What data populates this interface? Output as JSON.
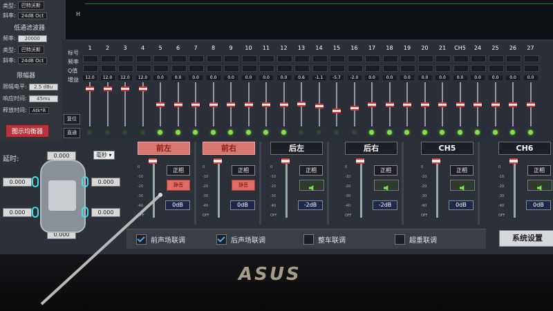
{
  "left_panel": {
    "rows": [
      {
        "label": "类型:",
        "value": "巴特沃斯"
      },
      {
        "label": "斜率:",
        "value": "24dB Oct"
      },
      {
        "label": "",
        "value": "低通滤波器"
      },
      {
        "label": "频率:",
        "value": "20000"
      },
      {
        "label": "类型:",
        "value": "巴特沃斯"
      },
      {
        "label": "斜率:",
        "value": "24dB Oct"
      }
    ],
    "limiter_title": "限幅器",
    "limiter_rows": [
      {
        "label": "限幅电平:",
        "value": "2.5 dBu"
      },
      {
        "label": "响应时间:",
        "value": "45ms"
      },
      {
        "label": "释放时间:",
        "value": "Atk*8"
      }
    ],
    "eq_button": "图示均衡器"
  },
  "graph": {
    "axis_letter": "H"
  },
  "eq": {
    "row_labels": [
      "标号",
      "频率",
      "Q值",
      "增益"
    ],
    "reset_label": "复位",
    "direct_label": "直通",
    "bands": [
      {
        "n": "1",
        "gain": "12.0",
        "level": 0.9,
        "led": false
      },
      {
        "n": "2",
        "gain": "12.0",
        "level": 0.9,
        "led": false
      },
      {
        "n": "3",
        "gain": "12.0",
        "level": 0.9,
        "led": false
      },
      {
        "n": "4",
        "gain": "12.0",
        "level": 0.9,
        "led": false
      },
      {
        "n": "5",
        "gain": "0.0",
        "level": 0.5,
        "led": true
      },
      {
        "n": "6",
        "gain": "0.0",
        "level": 0.5,
        "led": true
      },
      {
        "n": "7",
        "gain": "0.0",
        "level": 0.5,
        "led": true
      },
      {
        "n": "8",
        "gain": "0.0",
        "level": 0.5,
        "led": true
      },
      {
        "n": "9",
        "gain": "0.0",
        "level": 0.5,
        "led": true
      },
      {
        "n": "10",
        "gain": "0.0",
        "level": 0.5,
        "led": true
      },
      {
        "n": "11",
        "gain": "0.0",
        "level": 0.5,
        "led": true
      },
      {
        "n": "12",
        "gain": "0.0",
        "level": 0.5,
        "led": true
      },
      {
        "n": "13",
        "gain": "0.6",
        "level": 0.52,
        "led": false
      },
      {
        "n": "14",
        "gain": "-1.1",
        "level": 0.46,
        "led": false
      },
      {
        "n": "15",
        "gain": "-5.7",
        "level": 0.35,
        "led": false
      },
      {
        "n": "16",
        "gain": "-2.0",
        "level": 0.42,
        "led": false
      },
      {
        "n": "17",
        "gain": "0.0",
        "level": 0.5,
        "led": true
      },
      {
        "n": "18",
        "gain": "0.0",
        "level": 0.5,
        "led": true
      },
      {
        "n": "19",
        "gain": "0.0",
        "level": 0.5,
        "led": true
      },
      {
        "n": "20",
        "gain": "0.0",
        "level": 0.5,
        "led": true
      },
      {
        "n": "21",
        "gain": "0.0",
        "level": 0.5,
        "led": true
      },
      {
        "n": "CH5",
        "gain": "0.0",
        "level": 0.5,
        "led": true
      },
      {
        "n": "24",
        "gain": "0.0",
        "level": 0.5,
        "led": true
      },
      {
        "n": "25",
        "gain": "0.0",
        "level": 0.5,
        "led": true
      },
      {
        "n": "26",
        "gain": "0.0",
        "level": 0.5,
        "led": true
      },
      {
        "n": "27",
        "gain": "0.0",
        "level": 0.5,
        "led": true
      }
    ]
  },
  "delay": {
    "label": "延时:",
    "unit": "毫秒",
    "values": {
      "top": "0.000",
      "left_top": "0.000",
      "right_top": "0.000",
      "left_bottom": "0.000",
      "right_bottom": "0.000",
      "bottom": "0.000"
    }
  },
  "channels": [
    {
      "title": "前左",
      "active": true,
      "phase": "正相",
      "mute": "静音",
      "db": "0dB",
      "muted": true
    },
    {
      "title": "前右",
      "active": true,
      "phase": "正相",
      "mute": "静音",
      "db": "0dB",
      "muted": true
    },
    {
      "title": "后左",
      "active": false,
      "phase": "正相",
      "db": "-2dB",
      "muted": false
    },
    {
      "title": "后右",
      "active": false,
      "phase": "正相",
      "db": "-2dB",
      "muted": false
    },
    {
      "title": "CH5",
      "active": false,
      "phase": "正相",
      "db": "0dB",
      "muted": false
    },
    {
      "title": "CH6",
      "active": false,
      "phase": "正相",
      "db": "0dB",
      "muted": false
    }
  ],
  "fader_scale": [
    "0",
    "-10",
    "-20",
    "-30",
    "-40",
    "OFF"
  ],
  "links": [
    {
      "label": "前声场联调",
      "checked": true
    },
    {
      "label": "后声场联调",
      "checked": true
    },
    {
      "label": "整车联调",
      "checked": false
    },
    {
      "label": "超重联调",
      "checked": false
    }
  ],
  "system_button": "系统设置",
  "bezel_logo": "ASUS"
}
